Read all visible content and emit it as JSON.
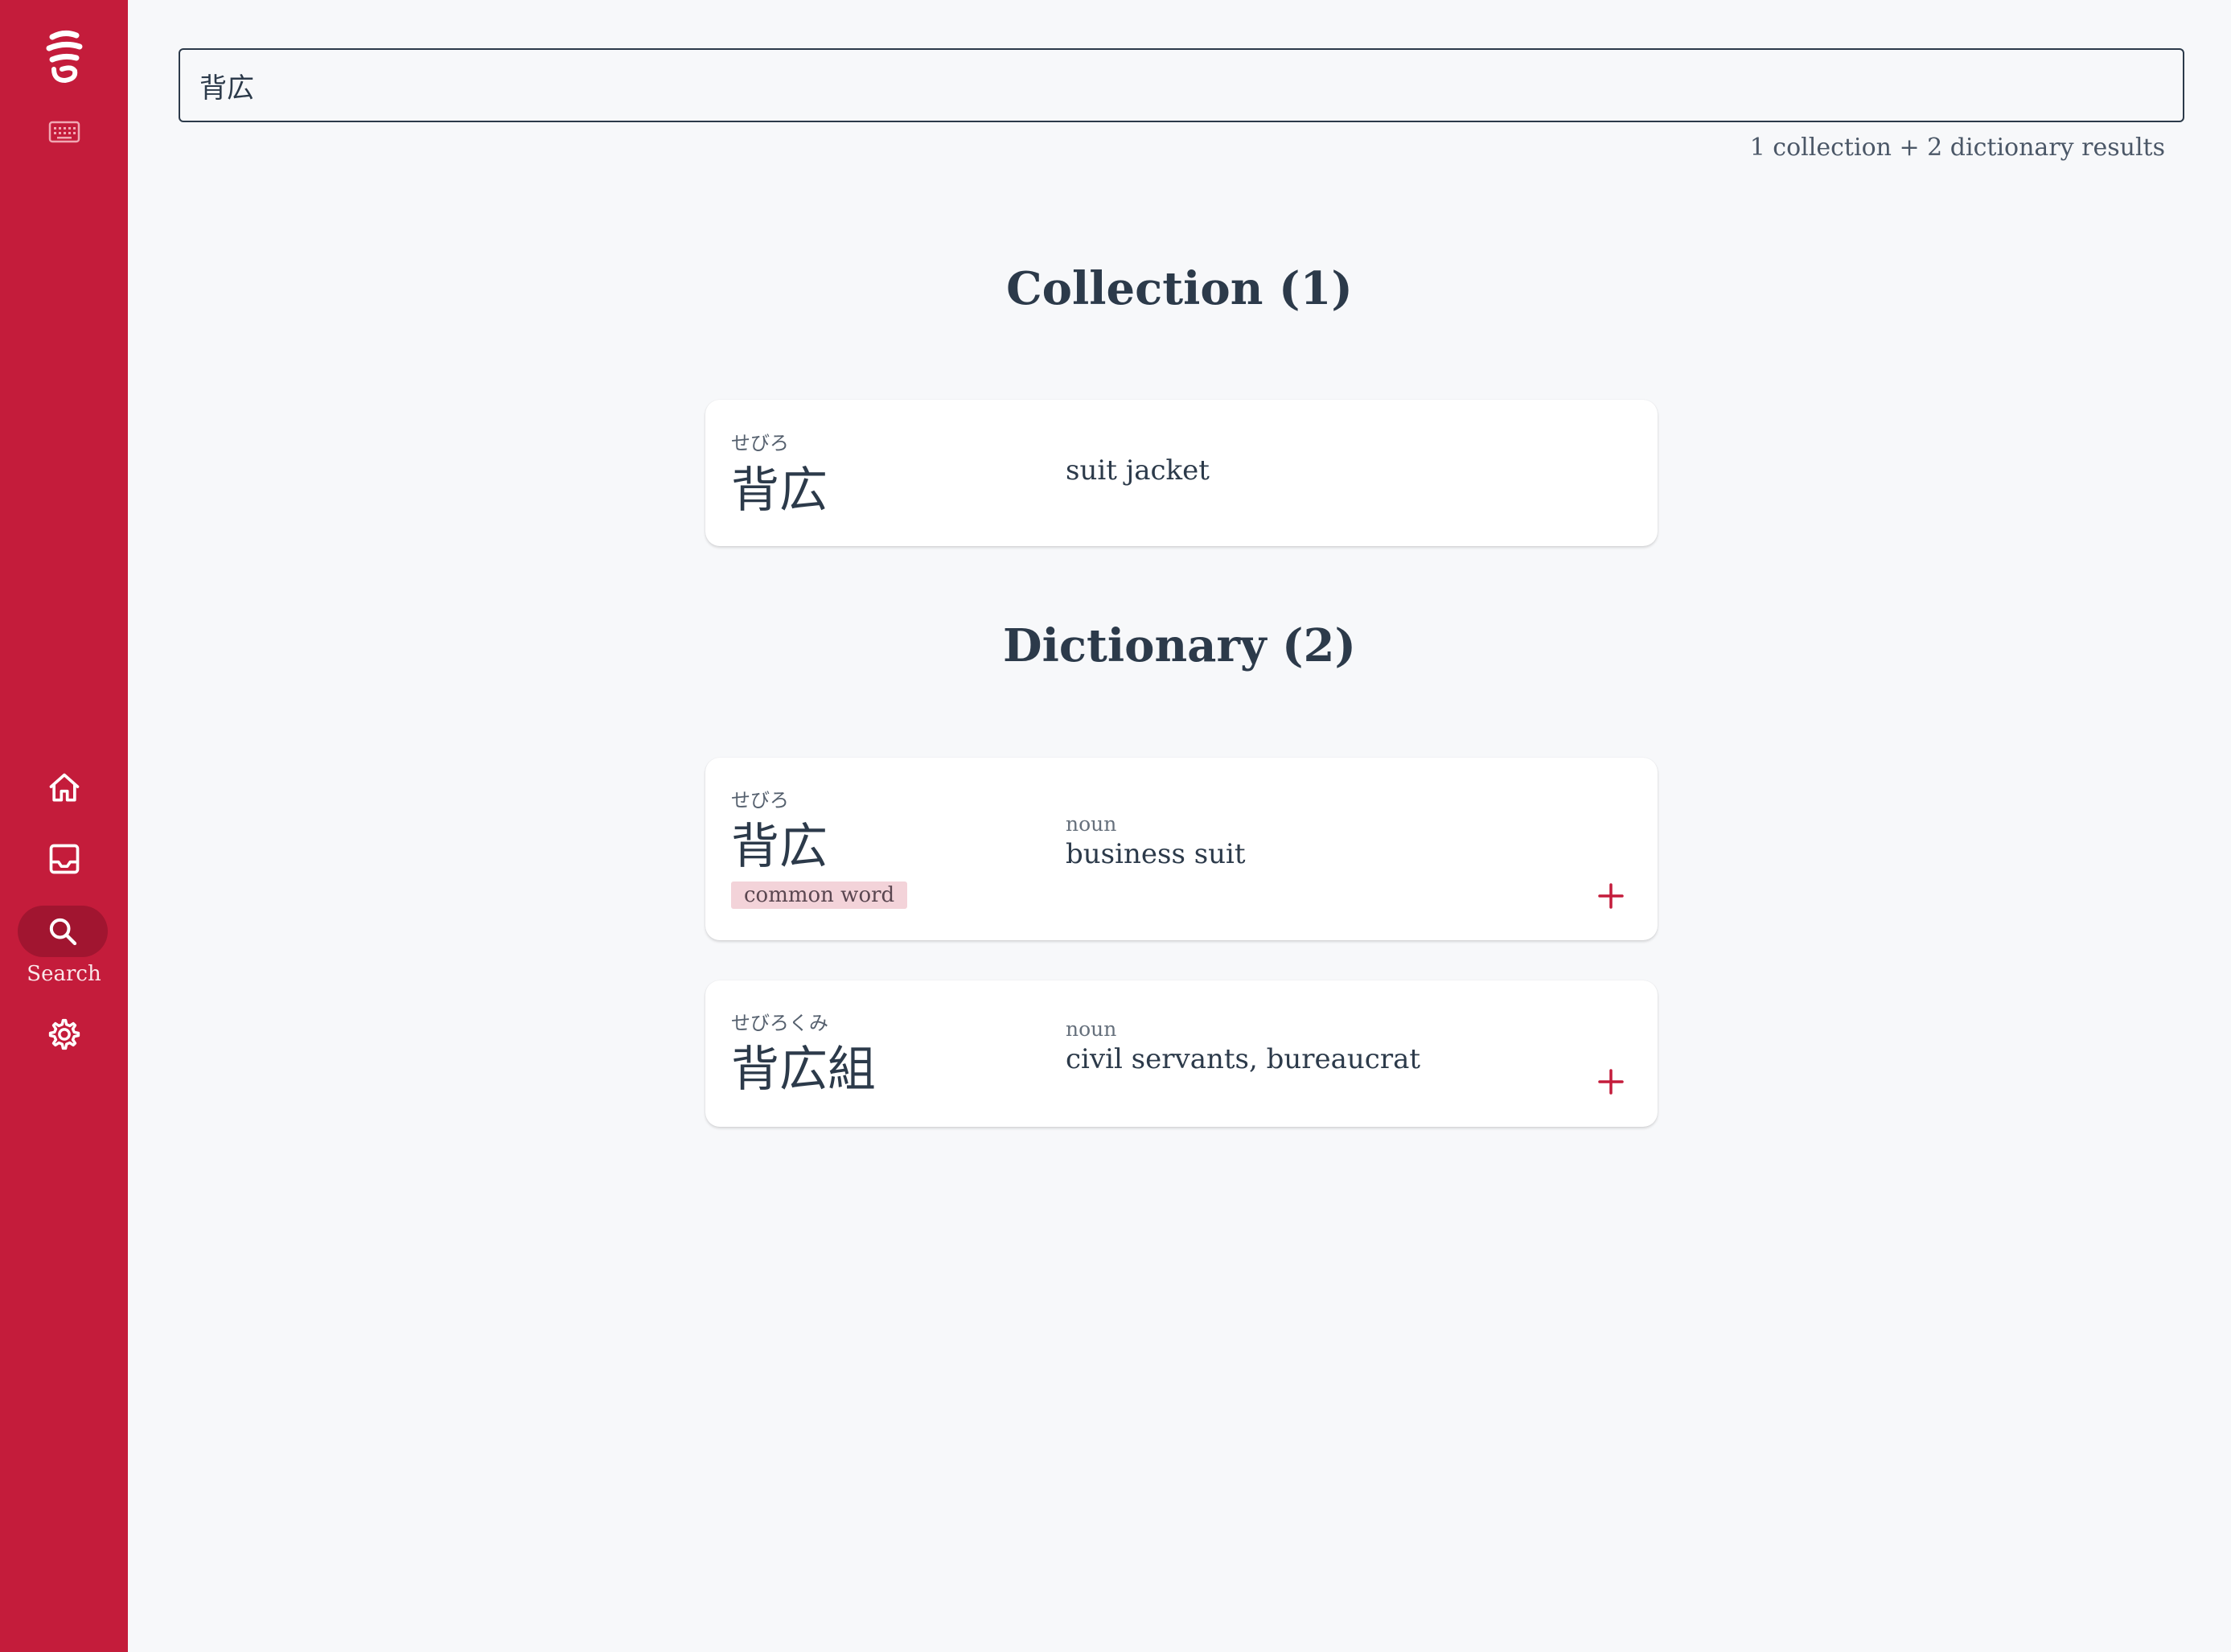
{
  "colors": {
    "brand": "#c41c3b",
    "active_pill": "#a11530",
    "tag_bg": "#f3d3d9",
    "background": "#f7f8fa",
    "text": "#2c3a4a"
  },
  "sidebar": {
    "icons": [
      "app-logo-icon",
      "keyboard-icon",
      "home-icon",
      "inbox-icon",
      "search-icon",
      "gear-icon"
    ],
    "active_label": "Search"
  },
  "search": {
    "value": "背広",
    "result_summary": "1 collection + 2 dictionary results"
  },
  "collection": {
    "title": "Collection (1)",
    "items": [
      {
        "reading": "せびろ",
        "word": "背広",
        "gloss": "suit jacket"
      }
    ]
  },
  "dictionary": {
    "title": "Dictionary (2)",
    "items": [
      {
        "reading": "せびろ",
        "word": "背広",
        "pos": "noun",
        "gloss": "business suit",
        "tag": "common word",
        "add_icon": "plus-icon"
      },
      {
        "reading": "せびろくみ",
        "word": "背広組",
        "pos": "noun",
        "gloss": "civil servants, bureaucrat",
        "add_icon": "plus-icon"
      }
    ]
  }
}
